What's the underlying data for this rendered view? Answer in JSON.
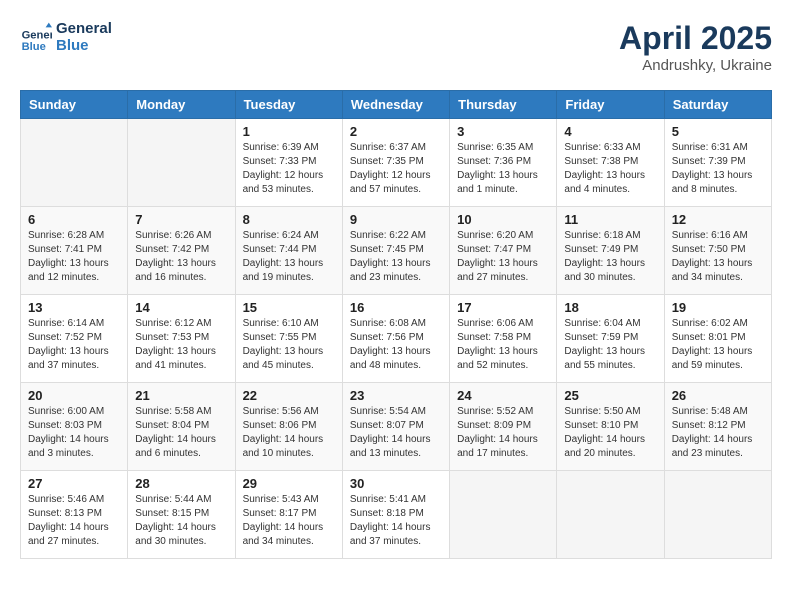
{
  "header": {
    "logo_line1": "General",
    "logo_line2": "Blue",
    "month": "April 2025",
    "location": "Andrushky, Ukraine"
  },
  "weekdays": [
    "Sunday",
    "Monday",
    "Tuesday",
    "Wednesday",
    "Thursday",
    "Friday",
    "Saturday"
  ],
  "weeks": [
    [
      {
        "day": "",
        "info": ""
      },
      {
        "day": "",
        "info": ""
      },
      {
        "day": "1",
        "info": "Sunrise: 6:39 AM\nSunset: 7:33 PM\nDaylight: 12 hours\nand 53 minutes."
      },
      {
        "day": "2",
        "info": "Sunrise: 6:37 AM\nSunset: 7:35 PM\nDaylight: 12 hours\nand 57 minutes."
      },
      {
        "day": "3",
        "info": "Sunrise: 6:35 AM\nSunset: 7:36 PM\nDaylight: 13 hours\nand 1 minute."
      },
      {
        "day": "4",
        "info": "Sunrise: 6:33 AM\nSunset: 7:38 PM\nDaylight: 13 hours\nand 4 minutes."
      },
      {
        "day": "5",
        "info": "Sunrise: 6:31 AM\nSunset: 7:39 PM\nDaylight: 13 hours\nand 8 minutes."
      }
    ],
    [
      {
        "day": "6",
        "info": "Sunrise: 6:28 AM\nSunset: 7:41 PM\nDaylight: 13 hours\nand 12 minutes."
      },
      {
        "day": "7",
        "info": "Sunrise: 6:26 AM\nSunset: 7:42 PM\nDaylight: 13 hours\nand 16 minutes."
      },
      {
        "day": "8",
        "info": "Sunrise: 6:24 AM\nSunset: 7:44 PM\nDaylight: 13 hours\nand 19 minutes."
      },
      {
        "day": "9",
        "info": "Sunrise: 6:22 AM\nSunset: 7:45 PM\nDaylight: 13 hours\nand 23 minutes."
      },
      {
        "day": "10",
        "info": "Sunrise: 6:20 AM\nSunset: 7:47 PM\nDaylight: 13 hours\nand 27 minutes."
      },
      {
        "day": "11",
        "info": "Sunrise: 6:18 AM\nSunset: 7:49 PM\nDaylight: 13 hours\nand 30 minutes."
      },
      {
        "day": "12",
        "info": "Sunrise: 6:16 AM\nSunset: 7:50 PM\nDaylight: 13 hours\nand 34 minutes."
      }
    ],
    [
      {
        "day": "13",
        "info": "Sunrise: 6:14 AM\nSunset: 7:52 PM\nDaylight: 13 hours\nand 37 minutes."
      },
      {
        "day": "14",
        "info": "Sunrise: 6:12 AM\nSunset: 7:53 PM\nDaylight: 13 hours\nand 41 minutes."
      },
      {
        "day": "15",
        "info": "Sunrise: 6:10 AM\nSunset: 7:55 PM\nDaylight: 13 hours\nand 45 minutes."
      },
      {
        "day": "16",
        "info": "Sunrise: 6:08 AM\nSunset: 7:56 PM\nDaylight: 13 hours\nand 48 minutes."
      },
      {
        "day": "17",
        "info": "Sunrise: 6:06 AM\nSunset: 7:58 PM\nDaylight: 13 hours\nand 52 minutes."
      },
      {
        "day": "18",
        "info": "Sunrise: 6:04 AM\nSunset: 7:59 PM\nDaylight: 13 hours\nand 55 minutes."
      },
      {
        "day": "19",
        "info": "Sunrise: 6:02 AM\nSunset: 8:01 PM\nDaylight: 13 hours\nand 59 minutes."
      }
    ],
    [
      {
        "day": "20",
        "info": "Sunrise: 6:00 AM\nSunset: 8:03 PM\nDaylight: 14 hours\nand 3 minutes."
      },
      {
        "day": "21",
        "info": "Sunrise: 5:58 AM\nSunset: 8:04 PM\nDaylight: 14 hours\nand 6 minutes."
      },
      {
        "day": "22",
        "info": "Sunrise: 5:56 AM\nSunset: 8:06 PM\nDaylight: 14 hours\nand 10 minutes."
      },
      {
        "day": "23",
        "info": "Sunrise: 5:54 AM\nSunset: 8:07 PM\nDaylight: 14 hours\nand 13 minutes."
      },
      {
        "day": "24",
        "info": "Sunrise: 5:52 AM\nSunset: 8:09 PM\nDaylight: 14 hours\nand 17 minutes."
      },
      {
        "day": "25",
        "info": "Sunrise: 5:50 AM\nSunset: 8:10 PM\nDaylight: 14 hours\nand 20 minutes."
      },
      {
        "day": "26",
        "info": "Sunrise: 5:48 AM\nSunset: 8:12 PM\nDaylight: 14 hours\nand 23 minutes."
      }
    ],
    [
      {
        "day": "27",
        "info": "Sunrise: 5:46 AM\nSunset: 8:13 PM\nDaylight: 14 hours\nand 27 minutes."
      },
      {
        "day": "28",
        "info": "Sunrise: 5:44 AM\nSunset: 8:15 PM\nDaylight: 14 hours\nand 30 minutes."
      },
      {
        "day": "29",
        "info": "Sunrise: 5:43 AM\nSunset: 8:17 PM\nDaylight: 14 hours\nand 34 minutes."
      },
      {
        "day": "30",
        "info": "Sunrise: 5:41 AM\nSunset: 8:18 PM\nDaylight: 14 hours\nand 37 minutes."
      },
      {
        "day": "",
        "info": ""
      },
      {
        "day": "",
        "info": ""
      },
      {
        "day": "",
        "info": ""
      }
    ]
  ]
}
